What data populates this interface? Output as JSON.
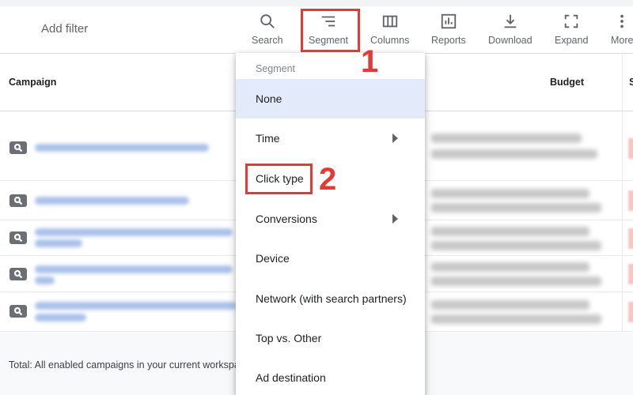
{
  "toolbar": {
    "add_filter": "Add filter",
    "buttons": [
      {
        "label": "Search",
        "icon": "search-icon"
      },
      {
        "label": "Segment",
        "icon": "segment-icon"
      },
      {
        "label": "Columns",
        "icon": "columns-icon"
      },
      {
        "label": "Reports",
        "icon": "reports-icon"
      },
      {
        "label": "Download",
        "icon": "download-icon"
      },
      {
        "label": "Expand",
        "icon": "expand-icon"
      },
      {
        "label": "More",
        "icon": "more-vert-icon"
      }
    ]
  },
  "table": {
    "columns": {
      "campaign": "Campaign",
      "budget": "Budget",
      "status_partial": "S"
    },
    "total": "Total: All enabled campaigns in your current workspace"
  },
  "menu": {
    "header": "Segment",
    "items": [
      {
        "label": "None",
        "selected": true
      },
      {
        "label": "Time",
        "submenu": true
      },
      {
        "label": "Click type"
      },
      {
        "label": "Conversions",
        "submenu": true
      },
      {
        "label": "Device"
      },
      {
        "label": "Network (with search partners)"
      },
      {
        "label": "Top vs. Other"
      },
      {
        "label": "Ad destination"
      }
    ]
  },
  "annotations": {
    "step1": "1",
    "step2": "2",
    "color": "#e53935"
  },
  "colors": {
    "selected_bg": "#e3ebfb",
    "border": "#dadce0"
  }
}
